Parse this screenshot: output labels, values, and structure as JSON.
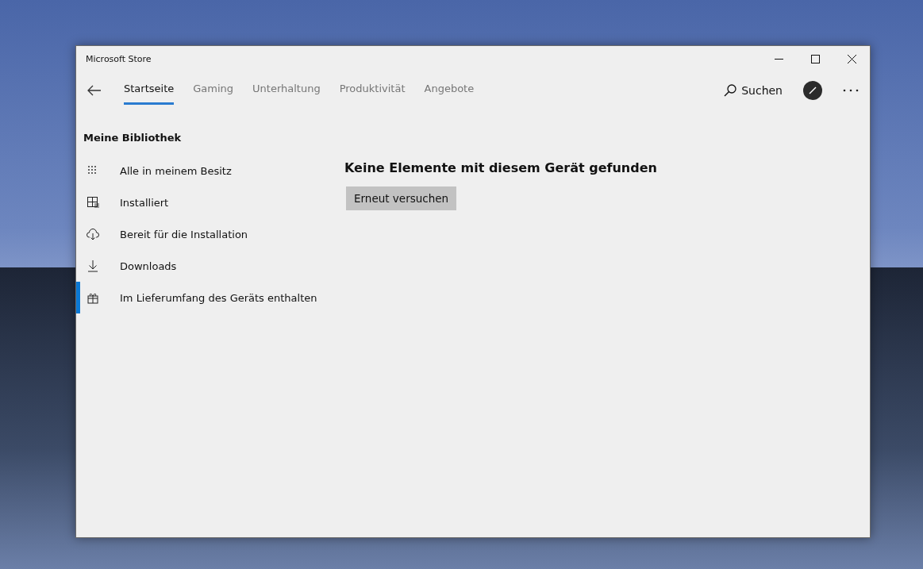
{
  "window": {
    "title": "Microsoft Store"
  },
  "tabs": [
    {
      "label": "Startseite",
      "selected": true
    },
    {
      "label": "Gaming",
      "selected": false
    },
    {
      "label": "Unterhaltung",
      "selected": false
    },
    {
      "label": "Produktivität",
      "selected": false
    },
    {
      "label": "Angebote",
      "selected": false
    }
  ],
  "search": {
    "label": "Suchen"
  },
  "sidebar": {
    "title": "Meine Bibliothek",
    "items": [
      {
        "label": "Alle in meinem Besitz",
        "selected": false
      },
      {
        "label": "Installiert",
        "selected": false
      },
      {
        "label": "Bereit für die Installation",
        "selected": false
      },
      {
        "label": "Downloads",
        "selected": false
      },
      {
        "label": "Im Lieferumfang des Geräts enthalten",
        "selected": true
      }
    ]
  },
  "content": {
    "message": "Keine Elemente mit diesem Gerät gefunden",
    "retry_button": "Erneut versuchen"
  }
}
